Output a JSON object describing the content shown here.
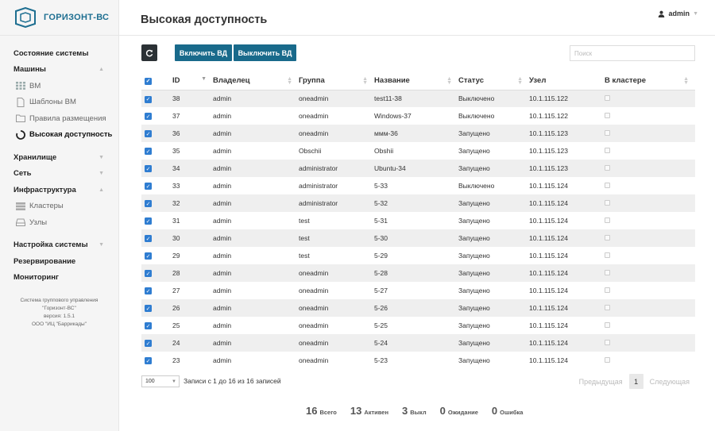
{
  "brand": {
    "name": "ГОРИЗОНТ-ВС"
  },
  "header": {
    "title": "Высокая доступность",
    "user": "admin"
  },
  "sidebar": {
    "items": [
      {
        "label": "Состояние системы",
        "type": "top"
      },
      {
        "label": "Машины",
        "type": "top",
        "chevron": "up"
      },
      {
        "label": "ВМ",
        "type": "sub",
        "icon": "grid-icon"
      },
      {
        "label": "Шаблоны ВМ",
        "type": "sub",
        "icon": "file-icon"
      },
      {
        "label": "Правила размещения",
        "type": "sub",
        "icon": "folder-icon"
      },
      {
        "label": "Высокая доступность",
        "type": "sub",
        "icon": "spinner-icon",
        "active": true
      },
      {
        "label": "Хранилище",
        "type": "top",
        "chevron": "down"
      },
      {
        "label": "Сеть",
        "type": "top",
        "chevron": "down"
      },
      {
        "label": "Инфраструктура",
        "type": "top",
        "chevron": "up"
      },
      {
        "label": "Кластеры",
        "type": "sub",
        "icon": "server-icon"
      },
      {
        "label": "Узлы",
        "type": "sub",
        "icon": "hdd-icon"
      },
      {
        "label": "Настройка системы",
        "type": "top",
        "chevron": "down"
      },
      {
        "label": "Резервирование",
        "type": "top"
      },
      {
        "label": "Мониторинг",
        "type": "top"
      }
    ],
    "footer": [
      "Система группового управления",
      "\"Горизонт-ВС\"",
      "версия: 1.5.1",
      "ООО \"ИЦ \"Баррикады\""
    ]
  },
  "toolbar": {
    "enable_label": "Включить ВД",
    "disable_label": "Выключить ВД",
    "search_placeholder": "Поиск"
  },
  "table": {
    "columns": [
      "ID",
      "Владелец",
      "Группа",
      "Название",
      "Статус",
      "Узел",
      "В кластере"
    ],
    "rows": [
      [
        "38",
        "admin",
        "oneadmin",
        "test11-38",
        "Выключено",
        "10.1.115.122"
      ],
      [
        "37",
        "admin",
        "oneadmin",
        "Windows-37",
        "Выключено",
        "10.1.115.122"
      ],
      [
        "36",
        "admin",
        "oneadmin",
        "ммм-36",
        "Запущено",
        "10.1.115.123"
      ],
      [
        "35",
        "admin",
        "Obschii",
        "Obshii",
        "Запущено",
        "10.1.115.123"
      ],
      [
        "34",
        "admin",
        "administrator",
        "Ubuntu-34",
        "Запущено",
        "10.1.115.123"
      ],
      [
        "33",
        "admin",
        "administrator",
        "5-33",
        "Выключено",
        "10.1.115.124"
      ],
      [
        "32",
        "admin",
        "administrator",
        "5-32",
        "Запущено",
        "10.1.115.124"
      ],
      [
        "31",
        "admin",
        "test",
        "5-31",
        "Запущено",
        "10.1.115.124"
      ],
      [
        "30",
        "admin",
        "test",
        "5-30",
        "Запущено",
        "10.1.115.124"
      ],
      [
        "29",
        "admin",
        "test",
        "5-29",
        "Запущено",
        "10.1.115.124"
      ],
      [
        "28",
        "admin",
        "oneadmin",
        "5-28",
        "Запущено",
        "10.1.115.124"
      ],
      [
        "27",
        "admin",
        "oneadmin",
        "5-27",
        "Запущено",
        "10.1.115.124"
      ],
      [
        "26",
        "admin",
        "oneadmin",
        "5-26",
        "Запущено",
        "10.1.115.124"
      ],
      [
        "25",
        "admin",
        "oneadmin",
        "5-25",
        "Запущено",
        "10.1.115.124"
      ],
      [
        "24",
        "admin",
        "oneadmin",
        "5-24",
        "Запущено",
        "10.1.115.124"
      ],
      [
        "23",
        "admin",
        "oneadmin",
        "5-23",
        "Запущено",
        "10.1.115.124"
      ]
    ]
  },
  "pagination": {
    "page_size": "100",
    "info": "Записи с 1 до 16 из 16 записей",
    "prev": "Предыдущая",
    "current": "1",
    "next": "Следующая"
  },
  "stats": [
    {
      "num": "16",
      "label": "Всего"
    },
    {
      "num": "13",
      "label": "Активен"
    },
    {
      "num": "3",
      "label": "Выкл"
    },
    {
      "num": "0",
      "label": "Ожидание"
    },
    {
      "num": "0",
      "label": "Ошибка"
    }
  ],
  "colors": {
    "accent": "#196a8b",
    "checkbox": "#2f7dd1"
  }
}
